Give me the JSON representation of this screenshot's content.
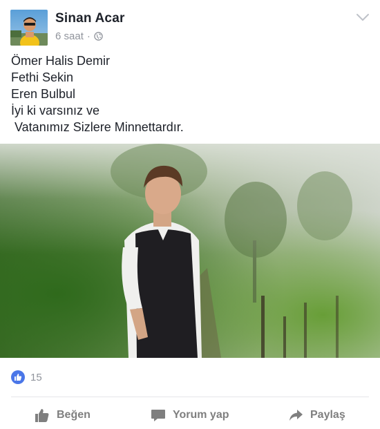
{
  "post": {
    "author": "Sinan Acar",
    "time": "6 saat",
    "separator": "·",
    "privacy_icon": "globe-icon",
    "menu_icon": "chevron-down-icon",
    "text_lines": [
      "Ömer Halis Demir",
      "Fethi Sekin",
      "Eren Bulbul",
      "İyi ki varsınız ve",
      " Vatanımız Sizlere Minnettardır."
    ],
    "photo_icon": "post-photo"
  },
  "reactions": {
    "icon": "like-reaction-icon",
    "count": "15"
  },
  "actions": {
    "like_label": "Beğen",
    "comment_label": "Yorum yap",
    "share_label": "Paylaş"
  },
  "colors": {
    "brand_blue": "#4a76e8",
    "meta_gray": "#90949c",
    "action_gray": "#7f7f7f",
    "text": "#1d2129"
  }
}
